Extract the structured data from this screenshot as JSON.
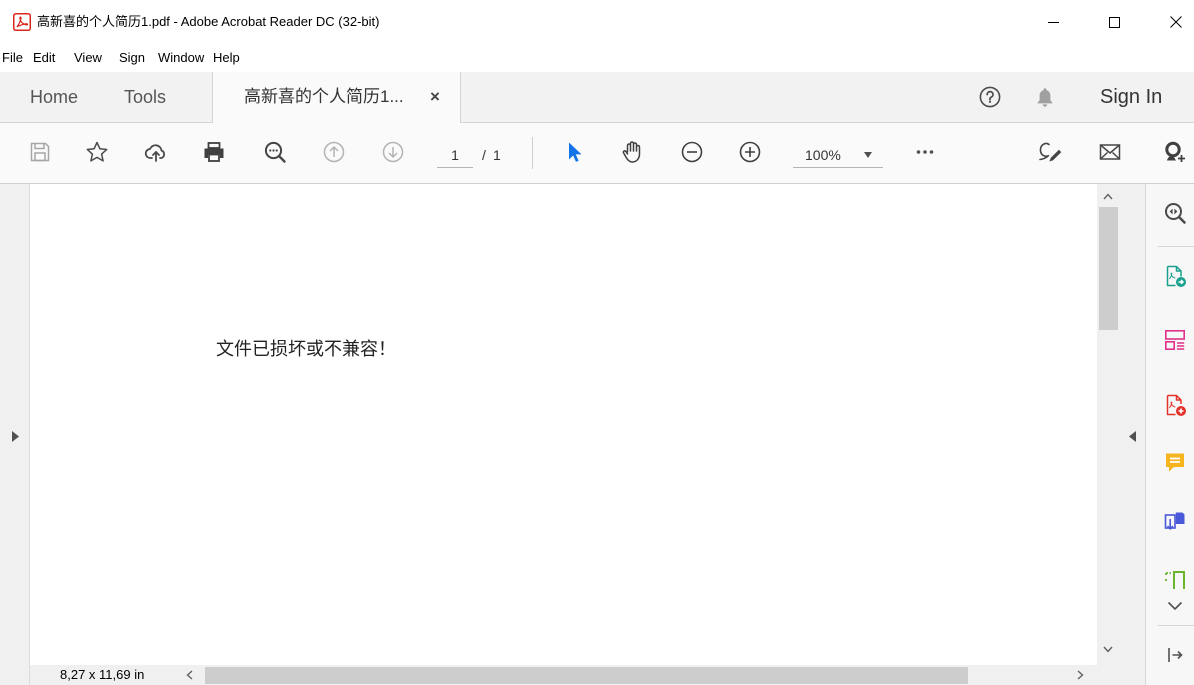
{
  "window": {
    "title": "高新喜的个人简历1.pdf - Adobe Acrobat Reader DC (32-bit)",
    "app_icon": "acrobat-reader-icon",
    "controls": [
      "minimize-icon",
      "maximize-icon",
      "close-icon"
    ]
  },
  "menu": [
    {
      "label": "File"
    },
    {
      "label": "Edit"
    },
    {
      "label": "View"
    },
    {
      "label": "Sign"
    },
    {
      "label": "Window"
    },
    {
      "label": "Help"
    }
  ],
  "tabs": [
    {
      "label": "Home",
      "active": false
    },
    {
      "label": "Tools",
      "active": false
    },
    {
      "label": "高新喜的个人简历1...",
      "active": true,
      "close_label": "×"
    }
  ],
  "header_right": {
    "help_icon": "help-icon",
    "notifications_icon": "bell-icon",
    "sign_in": "Sign In"
  },
  "toolbar": {
    "file_tools": [
      "save-icon",
      "bookmark-star-icon",
      "cloud-upload-icon",
      "print-icon",
      "find-text-icon"
    ],
    "page_nav": {
      "previous_icon": "previous-page-icon",
      "next_icon": "next-page-icon",
      "current": "1",
      "separator": "/",
      "total": "1"
    },
    "view_tools": [
      "select-pointer-icon",
      "hand-tool-icon",
      "zoom-out-icon",
      "zoom-in-icon"
    ],
    "active_tool": "select-pointer-icon",
    "zoom": {
      "value": "100%",
      "dropdown_icon": "caret-down-icon"
    },
    "more_icon": "more-tools-icon",
    "share_tools": [
      "fill-sign-icon",
      "email-icon",
      "add-user-icon"
    ]
  },
  "document": {
    "message": "文件已损坏或不兼容！",
    "page_size": "8,27 x 11,69 in"
  },
  "panels": {
    "left_expand_icon": "expand-left-panel-icon",
    "right_collapse_icon": "collapse-right-panel-icon"
  },
  "right_pane": {
    "tools": [
      {
        "icon": "zoom-pane-icon"
      },
      {
        "icon": "export-pdf-icon",
        "color": "#19a08e"
      },
      {
        "icon": "organize-pages-icon",
        "color": "#e0308a"
      },
      {
        "icon": "create-pdf-icon",
        "color": "#e3322a"
      },
      {
        "icon": "comment-icon",
        "color": "#f6b51e"
      },
      {
        "icon": "combine-files-icon",
        "color": "#4a59d9"
      },
      {
        "icon": "edit-pdf-icon",
        "color": "#6ab42e"
      }
    ],
    "more_icon": "chevron-down-icon",
    "collapse_icon": "collapse-pane-icon"
  },
  "colors": {
    "accent": "#1473e6",
    "acrobat_red": "#d8271c",
    "tab_bar_background": "#f2f2f2",
    "toolbar_background": "#fafafa",
    "icon_default": "#454545",
    "icon_disabled": "#b3b3b3"
  }
}
